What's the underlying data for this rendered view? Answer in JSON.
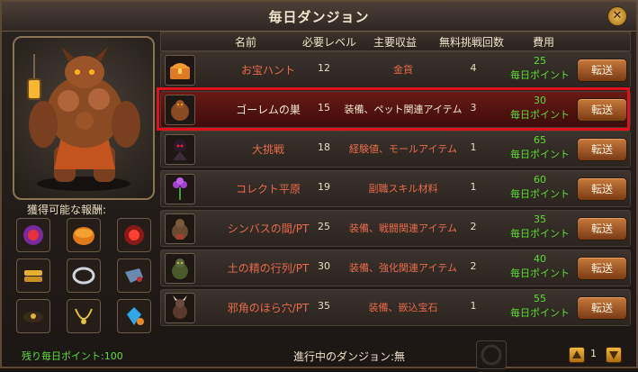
{
  "window": {
    "title": "毎日ダンジョン"
  },
  "columns": {
    "name": "名前",
    "level": "必要レベル",
    "gain": "主要収益",
    "count": "無料挑戦回数",
    "cost": "費用"
  },
  "rows": [
    {
      "name": "お宝ハント",
      "level": "12",
      "gain": "金貨",
      "count": "4",
      "cost": "25",
      "cost_unit": "毎日ポイント",
      "button": "転送",
      "icon": "treasure-chest-icon",
      "selected": false
    },
    {
      "name": "ゴーレムの巣",
      "level": "15",
      "gain": "装備、ペット関連アイテム",
      "count": "3",
      "cost": "30",
      "cost_unit": "毎日ポイント",
      "button": "転送",
      "icon": "golem-icon",
      "selected": true
    },
    {
      "name": "大挑戦",
      "level": "18",
      "gain": "経験値、モールアイテム",
      "count": "1",
      "cost": "65",
      "cost_unit": "毎日ポイント",
      "button": "転送",
      "icon": "dark-knight-icon",
      "selected": false
    },
    {
      "name": "コレクト平原",
      "level": "19",
      "gain": "副職スキル材料",
      "count": "1",
      "cost": "60",
      "cost_unit": "毎日ポイント",
      "button": "転送",
      "icon": "purple-flower-icon",
      "selected": false
    },
    {
      "name": "シンバスの間/PT",
      "level": "25",
      "gain": "装備、戦闘関連アイテム",
      "count": "2",
      "cost": "35",
      "cost_unit": "毎日ポイント",
      "button": "転送",
      "icon": "beast-icon",
      "selected": false
    },
    {
      "name": "土の精の行列/PT",
      "level": "30",
      "gain": "装備、強化関連アイテム",
      "count": "2",
      "cost": "40",
      "cost_unit": "毎日ポイント",
      "button": "転送",
      "icon": "earth-spirit-icon",
      "selected": false
    },
    {
      "name": "邪角のほら穴/PT",
      "level": "35",
      "gain": "装備、嵌込宝石",
      "count": "1",
      "cost": "55",
      "cost_unit": "毎日ポイント",
      "button": "転送",
      "icon": "horned-demon-icon",
      "selected": false
    }
  ],
  "rewards": {
    "label": "獲得可能な報酬:",
    "items": [
      "red-gem-icon",
      "mooncake-icon",
      "red-gem-icon",
      "gold-stack-icon",
      "silver-ring-icon",
      "gauntlet-icon",
      "dark-amulet-icon",
      "gold-necklace-icon",
      "blue-gem-icon"
    ]
  },
  "footer": {
    "remaining": "残り毎日ポイント:100",
    "progress": "進行中のダンジョン:無",
    "page": "1"
  },
  "colors": {
    "selection_border": "#e0101c",
    "green_text": "#5ddc35",
    "red_text": "#e86a4a"
  }
}
